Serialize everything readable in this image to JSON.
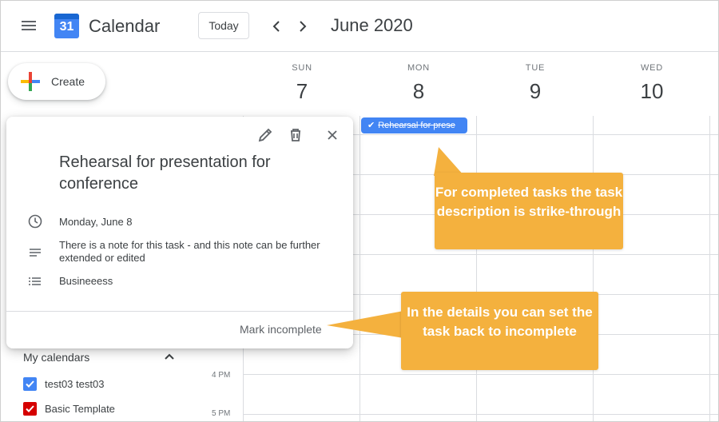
{
  "header": {
    "app_title": "Calendar",
    "logo_number": "31",
    "today_label": "Today",
    "month_title": "June 2020"
  },
  "create": {
    "label": "Create"
  },
  "days": [
    {
      "name": "SUN",
      "number": "7"
    },
    {
      "name": "MON",
      "number": "8"
    },
    {
      "name": "TUE",
      "number": "9"
    },
    {
      "name": "WED",
      "number": "10"
    }
  ],
  "task_chip": {
    "label": "Rehearsal for prese"
  },
  "popup": {
    "title": "Rehearsal for presentation for conference",
    "date": "Monday, June 8",
    "note": "There is a note for this task - and this note can be further extended or edited",
    "list": "Busineeess",
    "mark_label": "Mark incomplete"
  },
  "sidebar": {
    "my_calendars_label": "My calendars",
    "calendars": [
      {
        "label": "test03 test03",
        "color": "#4285f4"
      },
      {
        "label": "Basic Template",
        "color": "#d50000"
      }
    ]
  },
  "time_labels": [
    "4 PM",
    "5 PM"
  ],
  "callouts": {
    "strike": "For completed tasks the task description is strike-through",
    "incomplete": "In the details you can set the task back to incomplete"
  },
  "colors": {
    "accent": "#4285f4",
    "callout": "#f4b13e"
  }
}
